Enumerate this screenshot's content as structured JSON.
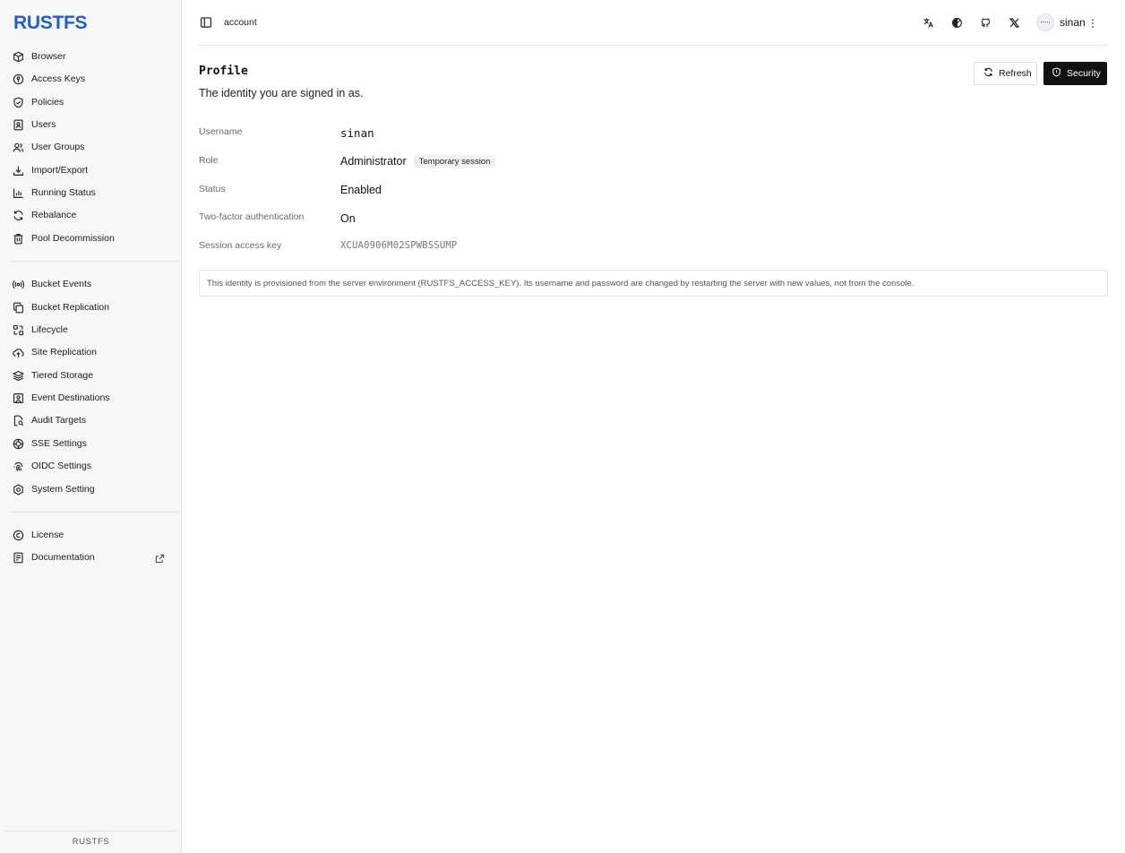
{
  "app": {
    "logo": "RUSTFS",
    "footer": "RUSTFS"
  },
  "sidebar": {
    "group1": [
      {
        "label": "Browser",
        "icon": "box-icon"
      },
      {
        "label": "Access Keys",
        "icon": "key-icon"
      },
      {
        "label": "Policies",
        "icon": "shield-check-icon"
      },
      {
        "label": "Users",
        "icon": "user-badge-icon"
      },
      {
        "label": "User Groups",
        "icon": "users-icon"
      },
      {
        "label": "Import/Export",
        "icon": "download-icon"
      },
      {
        "label": "Running Status",
        "icon": "bar-chart-icon"
      },
      {
        "label": "Rebalance",
        "icon": "refresh-icon"
      },
      {
        "label": "Pool Decommission",
        "icon": "trash-icon"
      }
    ],
    "group2": [
      {
        "label": "Bucket Events",
        "icon": "radio-icon"
      },
      {
        "label": "Bucket Replication",
        "icon": "copy-icon"
      },
      {
        "label": "Lifecycle",
        "icon": "lifecycle-icon"
      },
      {
        "label": "Site Replication",
        "icon": "cloud-upload-icon"
      },
      {
        "label": "Tiered Storage",
        "icon": "layers-icon"
      },
      {
        "label": "Event Destinations",
        "icon": "contact-icon"
      },
      {
        "label": "Audit Targets",
        "icon": "file-search-icon"
      },
      {
        "label": "SSE Settings",
        "icon": "key-settings-icon"
      },
      {
        "label": "OIDC Settings",
        "icon": "fingerprint-icon"
      },
      {
        "label": "System Setting",
        "icon": "settings-icon"
      }
    ],
    "group3": [
      {
        "label": "License",
        "icon": "copyright-icon"
      },
      {
        "label": "Documentation",
        "icon": "book-icon"
      }
    ]
  },
  "header": {
    "breadcrumb": "account",
    "user_name": "sinan"
  },
  "profile": {
    "title": "Profile",
    "subtitle": "The identity you are signed in as.",
    "refresh_label": "Refresh",
    "security_label": "Security",
    "fields": {
      "username_label": "Username",
      "username_value": "sinan",
      "role_label": "Role",
      "role_value": "Administrator",
      "role_badge": "Temporary session",
      "status_label": "Status",
      "status_value": "Enabled",
      "twofa_label": "Two-factor authentication",
      "twofa_value": "On",
      "session_key_label": "Session access key",
      "session_key_value": "XCUA0906M02SPWBSSUMP"
    },
    "notice": "This identity is provisioned from the server environment (RUSTFS_ACCESS_KEY). Its username and password are changed by restarting the server with new values, not from the console."
  }
}
